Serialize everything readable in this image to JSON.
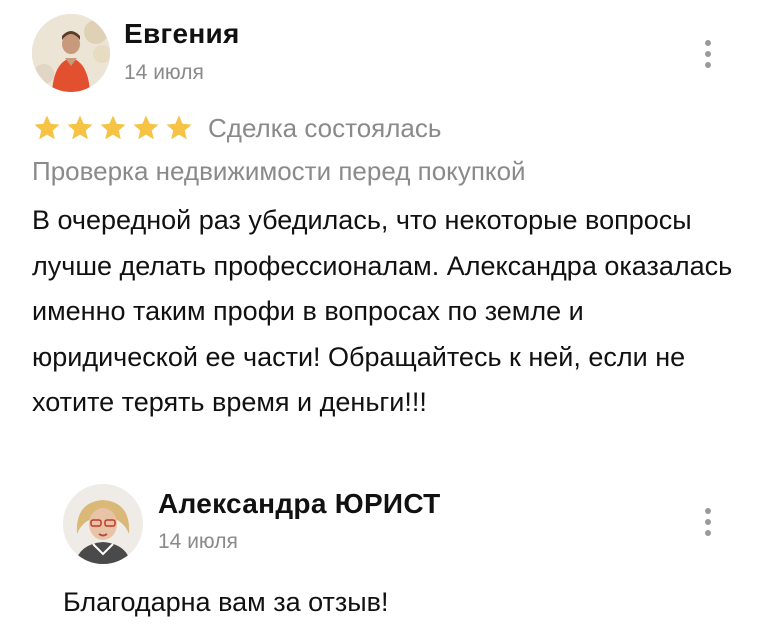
{
  "review": {
    "author": "Евгения",
    "date": "14 июля",
    "rating": 5,
    "rating_max": 5,
    "star_color": "#f6c344",
    "deal_status": "Сделка состоялась",
    "category": "Проверка недвижимости перед покупкой",
    "text": "В очередной раз убедилась, что некоторые вопросы лучше делать профессионалам. Александра оказалась именно таким профи в вопросах по земле и юридической ее части! Обращайтесь к ней, если не хотите терять время и деньги!!!",
    "menu_icon": "more-vertical-icon",
    "avatar_icon": "user-photo-avatar"
  },
  "reply": {
    "author": "Александра  ЮРИСТ",
    "date": "14 июля",
    "text": "Благодарна вам за отзыв!",
    "menu_icon": "more-vertical-icon",
    "avatar_icon": "user-photo-avatar"
  }
}
